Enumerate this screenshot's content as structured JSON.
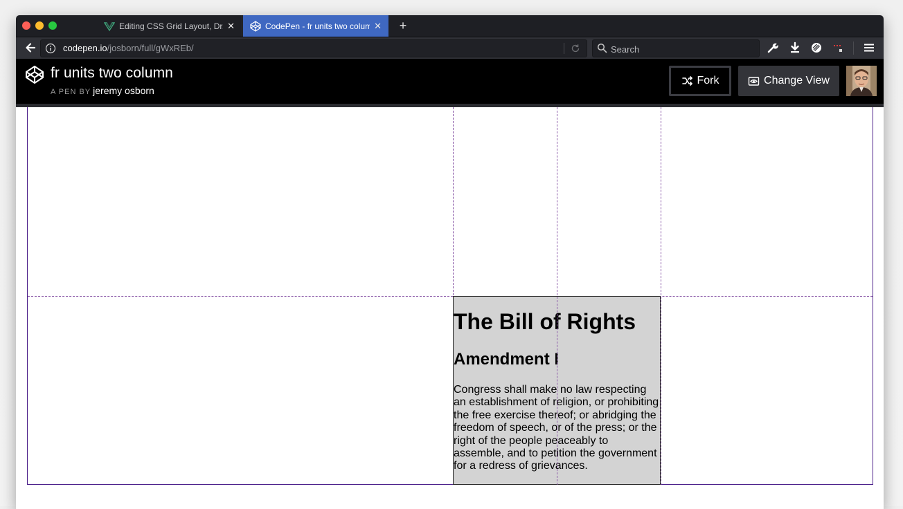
{
  "browser": {
    "tabs": [
      {
        "title": "Editing CSS Grid Layout, Dr. W",
        "active": false
      },
      {
        "title": "CodePen - fr units two column",
        "active": true
      }
    ],
    "url": {
      "domain": "codepen.io",
      "path": "/josborn/full/gWxREb/"
    },
    "search": {
      "placeholder": "Search"
    }
  },
  "codepen": {
    "title": "fr units two column",
    "byline_prefix": "A PEN BY",
    "author": "jeremy osborn",
    "fork_label": "Fork",
    "change_view_label": "Change View"
  },
  "article": {
    "heading": "The Bill of Rights",
    "subheading": "Amendment I",
    "body": "Congress shall make no law respecting an establishment of religion, or prohibiting the free exercise thereof; or abridging the freedom of speech, or of the press; or the right of the people peaceably to assemble, and to petition the government for a redress of grievances."
  },
  "colors": {
    "active_tab": "#3f68c1",
    "grid_line": "#8b5aa8",
    "grid_border": "#4b1f8a",
    "article_bg": "#d3d3d3",
    "header_bg": "#000000"
  },
  "icons": {
    "tab_inactive": "vue-logo-icon",
    "tab_active": "codepen-logo-icon",
    "back": "arrow-left-icon",
    "info": "info-icon",
    "reload": "reload-icon",
    "search": "search-icon",
    "tools": [
      "wrench-icon",
      "download-icon",
      "shield-icon",
      "extension-icon",
      "hamburger-menu-icon"
    ],
    "fork": "fork-icon",
    "change_view": "eye-window-icon"
  }
}
